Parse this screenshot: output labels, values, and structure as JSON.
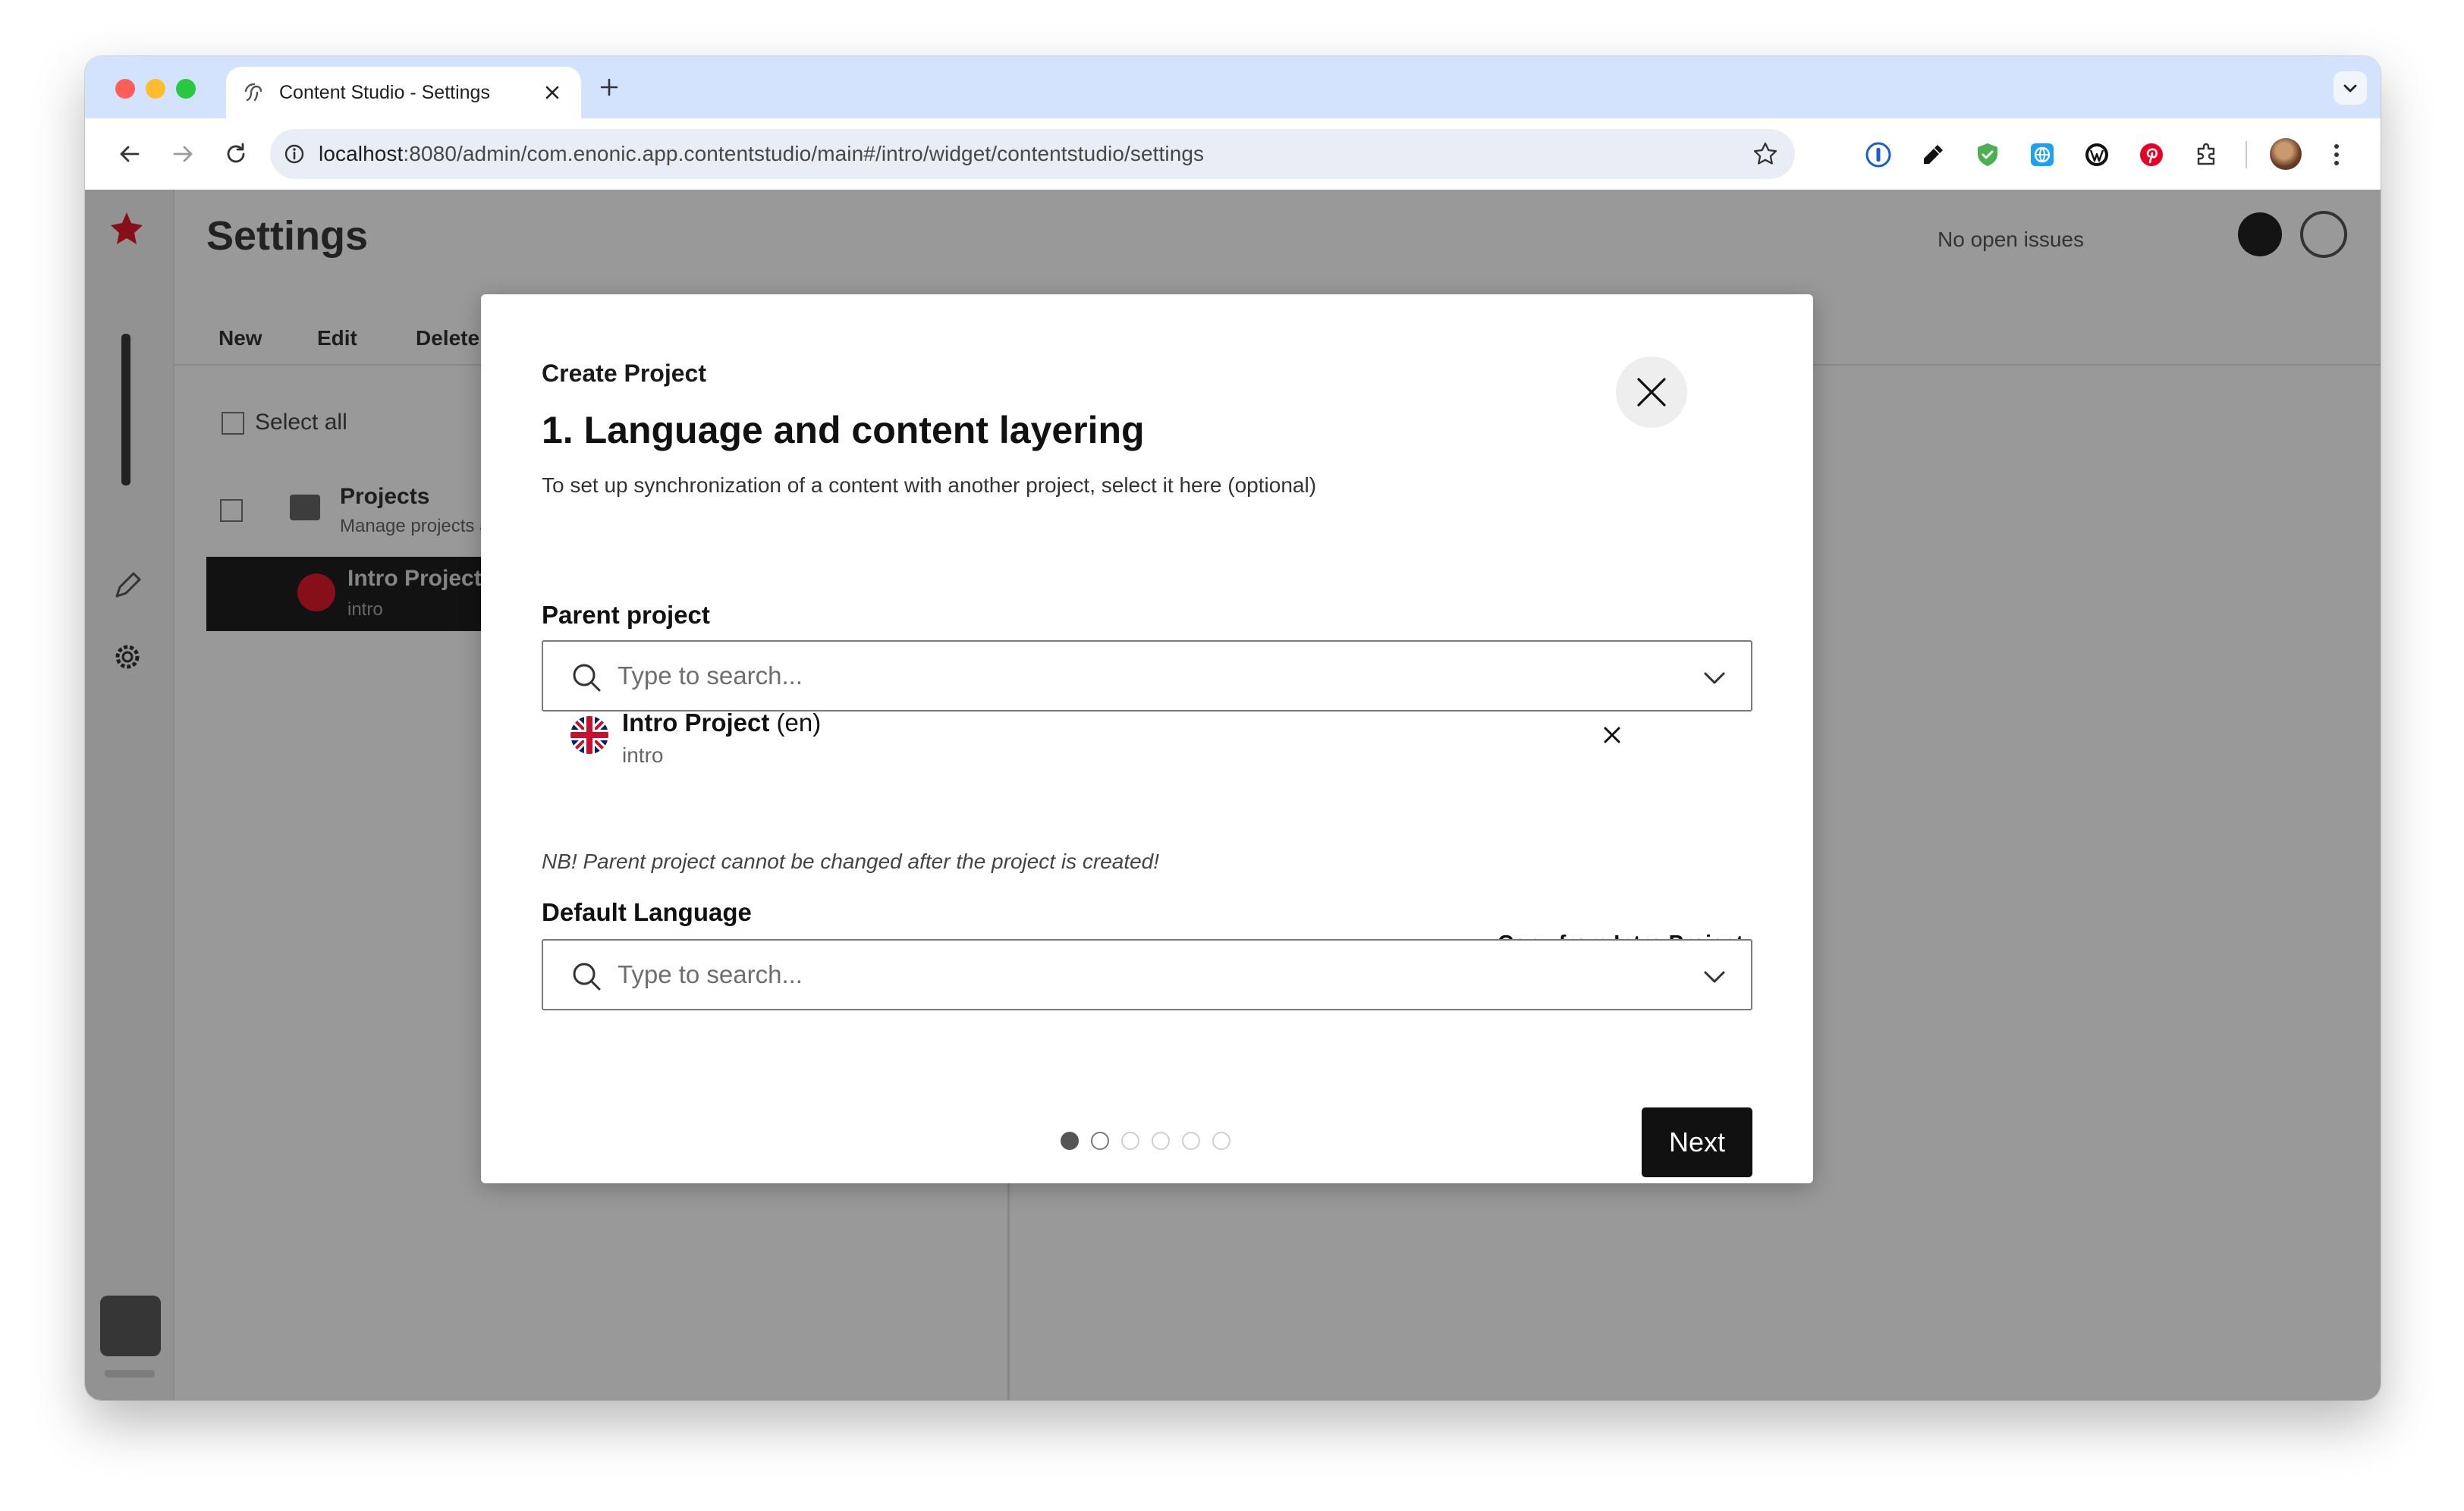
{
  "browser": {
    "tab_title": "Content Studio - Settings",
    "url_host": "localhost",
    "url_path": ":8080/admin/com.enonic.app.contentstudio/main#/intro/widget/contentstudio/settings"
  },
  "app": {
    "title": "Settings",
    "issues_label": "No open issues",
    "toolbar": {
      "new_label": "New",
      "edit_label": "Edit",
      "delete_label": "Delete"
    },
    "grid": {
      "select_all": "Select all"
    },
    "tree": [
      {
        "name": "Projects",
        "subtitle": "Manage projects and layers"
      },
      {
        "name": "Intro Project (en)",
        "subtitle": "intro"
      }
    ],
    "brand_color": "#e0192c"
  },
  "modal": {
    "kicker": "Create Project",
    "title": "1. Language and content layering",
    "subtitle": "To set up synchronization of a content with another project, select it here (optional)",
    "parent": {
      "label": "Parent project",
      "placeholder": "Type to search...",
      "selected": {
        "name": "Intro Project",
        "lang": "(en)",
        "id": "intro"
      },
      "note": "NB! Parent project cannot be changed after the project is created!"
    },
    "language": {
      "label": "Default Language",
      "copy_link": "Copy from Intro Project",
      "placeholder": "Type to search..."
    },
    "steps": {
      "total": 6,
      "current": 1
    },
    "next_label": "Next"
  }
}
